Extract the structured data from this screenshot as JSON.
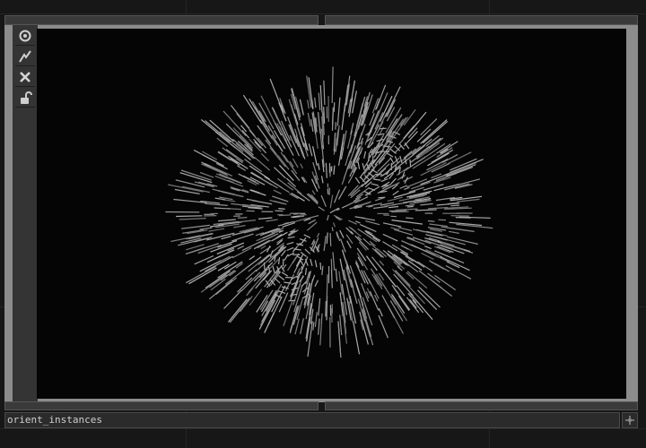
{
  "node": {
    "name": "orient_instances"
  },
  "toolbar": {
    "items": [
      {
        "icon": "target-icon"
      },
      {
        "icon": "lightning-icon"
      },
      {
        "icon": "close-icon"
      },
      {
        "icon": "unlock-icon"
      }
    ]
  },
  "corner": {
    "icon": "expand-icon"
  },
  "viewer": {
    "content": "instanced lines radiating from sphere"
  },
  "colors": {
    "background": "#171717",
    "frame": "#8c8c8c",
    "viewer": "#050505",
    "lines": "#9a9a9a"
  }
}
